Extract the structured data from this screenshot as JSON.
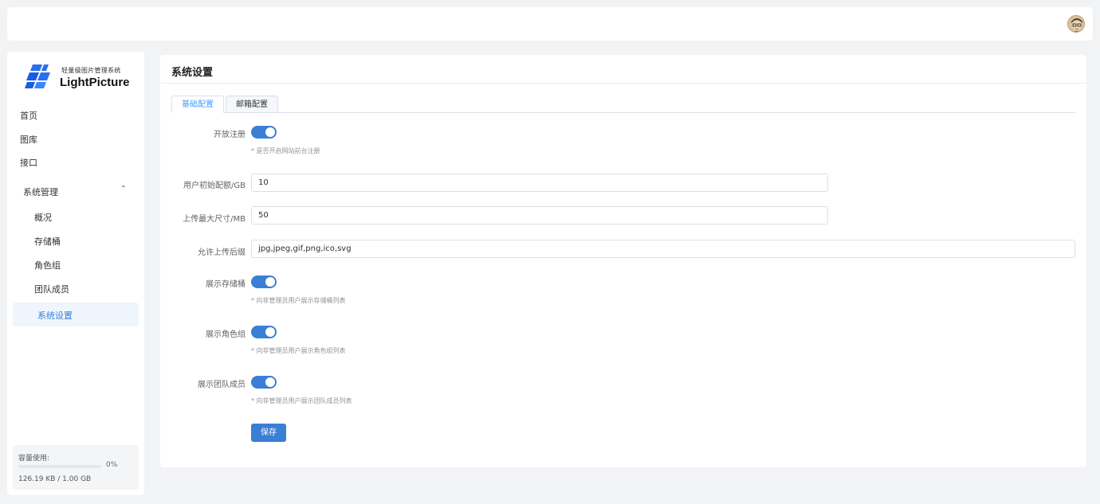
{
  "header": {
    "avatar_icon": "user-avatar"
  },
  "sidebar": {
    "logo": {
      "subtitle": "轻量级图片管理系统",
      "title": "LightPicture"
    },
    "items": [
      {
        "label": "首页"
      },
      {
        "label": "图库"
      },
      {
        "label": "接口"
      }
    ],
    "group": {
      "label": "系统管理",
      "expanded": true,
      "chevron_icon": "chevron-up-icon",
      "children": [
        {
          "label": "概况"
        },
        {
          "label": "存储桶"
        },
        {
          "label": "角色组"
        },
        {
          "label": "团队成员"
        },
        {
          "label": "系统设置",
          "active": true
        }
      ]
    },
    "usage": {
      "title": "容量使用:",
      "percent_text": "0%",
      "percent": 0,
      "size_text": "126.19 KB / 1.00 GB"
    }
  },
  "main": {
    "title": "系统设置",
    "tabs": [
      {
        "label": "基础配置",
        "active": true
      },
      {
        "label": "邮箱配置",
        "active": false
      }
    ],
    "form": {
      "open_register": {
        "label": "开放注册",
        "enabled": true,
        "hint": "* 是否开启网站前台注册"
      },
      "initial_quota": {
        "label": "用户初始配额/GB",
        "value": "10"
      },
      "max_upload": {
        "label": "上传最大尺寸/MB",
        "value": "50"
      },
      "allowed_ext": {
        "label": "允许上传后缀",
        "value": "jpg,jpeg,gif,png,ico,svg"
      },
      "show_bucket": {
        "label": "展示存储桶",
        "enabled": true,
        "hint": "* 向非管理员用户展示存储桶列表"
      },
      "show_role": {
        "label": "展示角色组",
        "enabled": true,
        "hint": "* 向非管理员用户展示角色组列表"
      },
      "show_team": {
        "label": "展示团队成员",
        "enabled": true,
        "hint": "* 向非管理员用户展示团队成员列表"
      },
      "save_label": "保存"
    }
  },
  "colors": {
    "accent": "#3a7fd5",
    "background": "#f2f3f5"
  }
}
